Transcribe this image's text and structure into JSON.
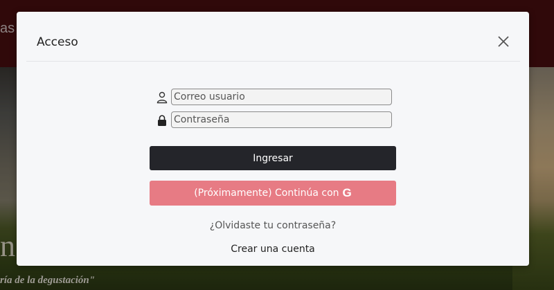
{
  "background": {
    "header_text": "as",
    "big_letter": "n",
    "tagline": "ría de la degustación\""
  },
  "modal": {
    "title": "Acceso",
    "close_icon": "close-icon",
    "email": {
      "placeholder": "Correo usuario",
      "icon": "user-icon"
    },
    "password": {
      "placeholder": "Contraseña",
      "icon": "lock-icon"
    },
    "login_button": "Ingresar",
    "google_button": "(Próximamente) Continúa con",
    "google_icon_glyph": "G",
    "forgot_link": "¿Olvidaste tu contraseña?",
    "create_link": "Crear una cuenta"
  },
  "colors": {
    "header_bg": "#4a0e10",
    "login_button_bg": "#24252a",
    "google_button_bg": "#e77b84",
    "modal_bg": "#f6f7f9"
  }
}
